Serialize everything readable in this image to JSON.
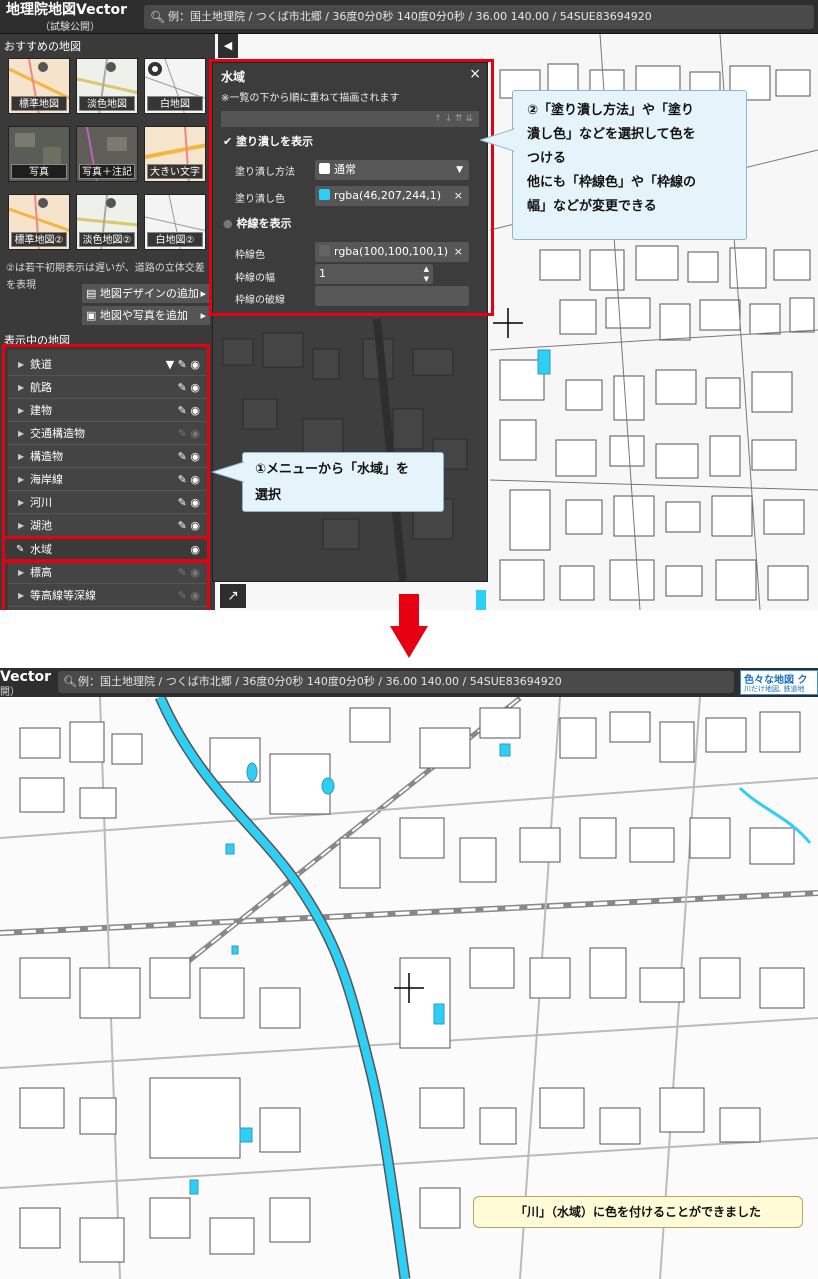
{
  "app": {
    "title": "地理院地図Vector",
    "subtitle": "（試験公開）",
    "title_cropped": "Vector",
    "subtitle_cropped": "開）",
    "search_placeholder": "例：国土地理院 / つくば市北郷 / 36度0分0秒 140度0分0秒  / 36.00 140.00 / 54SUE83694920",
    "search_placeholder_cropped": "例：国土地理院 / つくば市北郷 / 36度0分0秒 140度0分0秒  / 36.00 140.00 / 54SUE83694920",
    "search_icon": "search-icon"
  },
  "sidebar": {
    "recommended_title": "おすすめの地図",
    "thumbnails": [
      {
        "label": "標準地図"
      },
      {
        "label": "淡色地図"
      },
      {
        "label": "白地図"
      },
      {
        "label": "写真"
      },
      {
        "label": "写真＋注記"
      },
      {
        "label": "大きい文字"
      },
      {
        "label": "標準地図②"
      },
      {
        "label": "淡色地図②"
      },
      {
        "label": "白地図②"
      }
    ],
    "note": "②は若干初期表示は遅いが、道路の立体交差を表現",
    "add_design_label": "地図デザインの追加",
    "add_photo_label": "地図や写真を追加",
    "active_title": "表示中の地図",
    "layers": [
      {
        "label": "鉄道",
        "visible": true,
        "filter": true
      },
      {
        "label": "航路",
        "visible": true
      },
      {
        "label": "建物",
        "visible": true
      },
      {
        "label": "交通構造物",
        "visible": false
      },
      {
        "label": "構造物",
        "visible": true
      },
      {
        "label": "海岸線",
        "visible": true
      },
      {
        "label": "河川",
        "visible": true
      },
      {
        "label": "湖池",
        "visible": true
      },
      {
        "label": "水域",
        "visible": true,
        "selected": true
      },
      {
        "label": "標高",
        "visible": false
      },
      {
        "label": "等高線等深線",
        "visible": false
      }
    ]
  },
  "dialog": {
    "title": "水域",
    "close": "×",
    "note": "※一覧の下から順に重ねて描画されます",
    "order_buttons": "↑ ↓ ⇈ ⇊",
    "fill_toggle_label": "塗り潰しを表示",
    "fill_method_label": "塗り潰し方法",
    "fill_method_value": "通常",
    "fill_color_label": "塗り潰し色",
    "fill_color_value": "rgba(46,207,244,1)",
    "fill_color_hex": "#2ecff4",
    "stroke_toggle_label": "枠線を表示",
    "stroke_color_label": "枠線色",
    "stroke_color_value": "rgba(100,100,100,1)",
    "stroke_color_hex": "#646464",
    "stroke_width_label": "枠線の幅",
    "stroke_width_value": "1",
    "stroke_dash_label": "枠線の破線",
    "stroke_dash_value": ""
  },
  "callouts": {
    "step1_line1": "①メニューから「水域」を",
    "step1_line2": "選択",
    "step2_line1": "②「塗り潰し方法」や「塗り",
    "step2_line2": "潰し色」などを選択して色を",
    "step2_line3": "つける",
    "step2_line4": "他にも「枠線色」や「枠線の",
    "step2_line5": "幅」などが変更できる",
    "result": "「川」（水域）に色を付けることができました"
  },
  "banner": {
    "line1": "色々な地図 ク",
    "line2": "川だけ地図, 鉄道地"
  },
  "colors": {
    "highlight": "#e60012",
    "water": "#2ecff4",
    "panel": "#3a3a3a"
  }
}
